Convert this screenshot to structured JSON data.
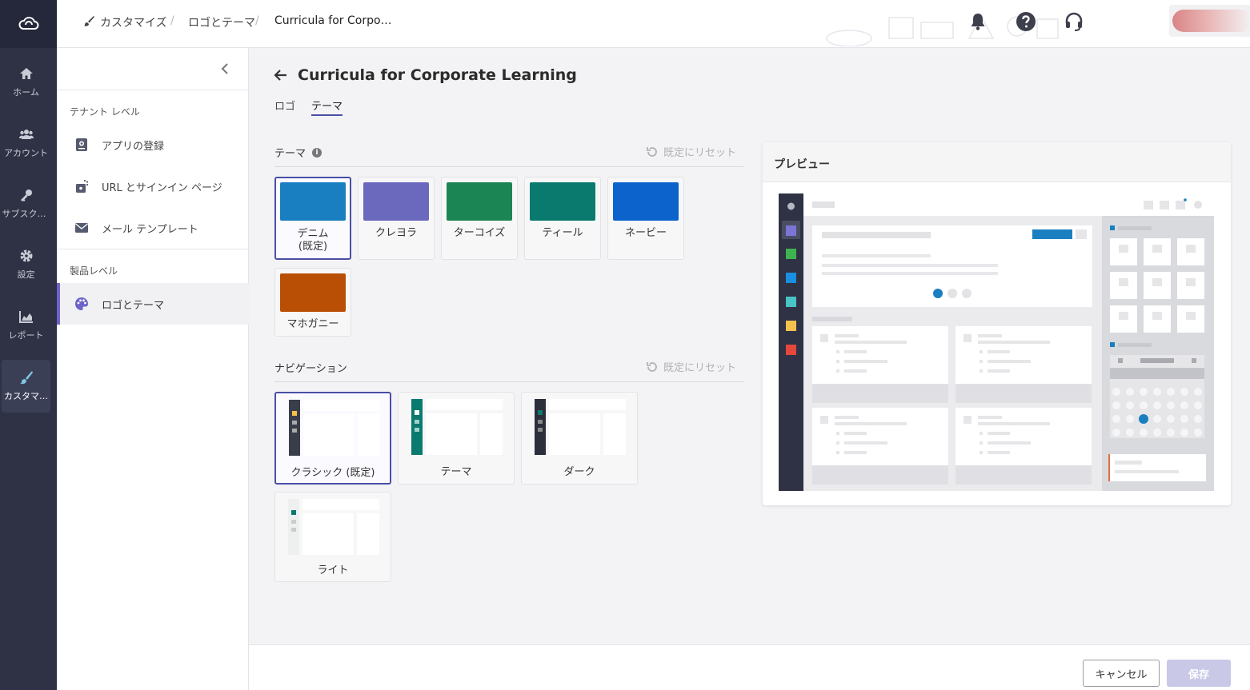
{
  "rail": {
    "items": [
      {
        "label": "ホーム",
        "icon": "home-icon"
      },
      {
        "label": "アカウント",
        "icon": "users-icon"
      },
      {
        "label": "サブスクリ…",
        "icon": "key-icon"
      },
      {
        "label": "設定",
        "icon": "gear-icon"
      },
      {
        "label": "レポート",
        "icon": "chart-icon"
      },
      {
        "label": "カスタマ…",
        "icon": "brush-icon"
      }
    ]
  },
  "breadcrumb": {
    "root": "カスタマイズ",
    "level2": "ロゴとテーマ",
    "current": "Curricula for Corpo…"
  },
  "sidebar": {
    "tenant_heading": "テナント レベル",
    "tenant_items": [
      {
        "label": "アプリの登録",
        "icon": "app-register-icon"
      },
      {
        "label": "URL とサインイン ページ",
        "icon": "url-signin-icon"
      },
      {
        "label": "メール テンプレート",
        "icon": "mail-icon"
      }
    ],
    "product_heading": "製品レベル",
    "product_items": [
      {
        "label": "ロゴとテーマ",
        "icon": "palette-icon"
      }
    ]
  },
  "page": {
    "title": "Curricula for Corporate Learning",
    "tabs": [
      {
        "label": "ロゴ"
      },
      {
        "label": "テーマ"
      }
    ],
    "active_tab": "テーマ"
  },
  "theme_section": {
    "label": "テーマ",
    "reset_label": "既定にリセット",
    "swatches": [
      {
        "label": "デニム\n(既定)",
        "color": "#1a7fc1",
        "selected": true
      },
      {
        "label": "クレヨラ",
        "color": "#6b69be"
      },
      {
        "label": "ターコイズ",
        "color": "#1b8553"
      },
      {
        "label": "ティール",
        "color": "#0a7a6e"
      },
      {
        "label": "ネービー",
        "color": "#0c63cc"
      },
      {
        "label": "マホガニー",
        "color": "#b94e05"
      }
    ]
  },
  "nav_section": {
    "label": "ナビゲーション",
    "reset_label": "既定にリセット",
    "options": [
      {
        "label": "クラシック (既定)",
        "selected": true
      },
      {
        "label": "テーマ"
      },
      {
        "label": "ダーク"
      },
      {
        "label": "ライト"
      }
    ]
  },
  "preview": {
    "title": "プレビュー"
  },
  "footer": {
    "cancel_label": "キャンセル",
    "save_label": "保存"
  }
}
